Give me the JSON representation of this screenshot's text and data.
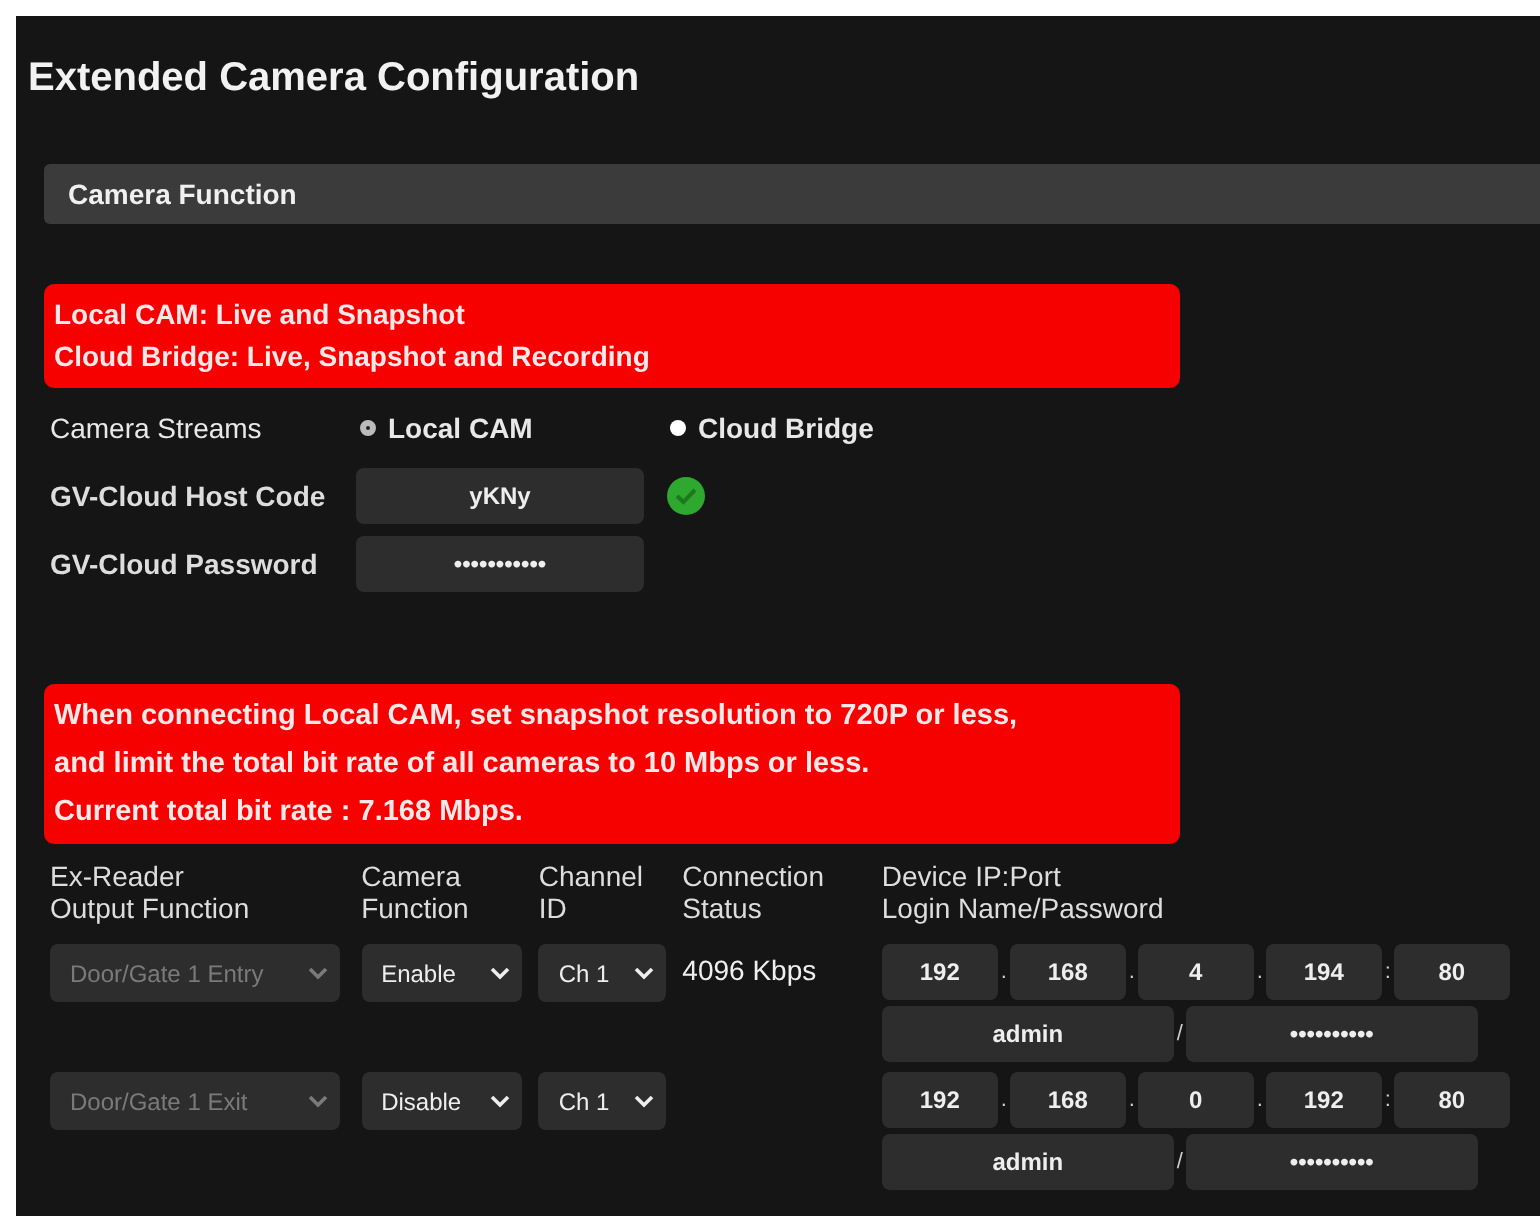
{
  "page_title": "Extended Camera Configuration",
  "section": {
    "title": "Camera Function"
  },
  "notice": [
    "Local CAM: Live and Snapshot",
    "Cloud Bridge: Live, Snapshot and Recording"
  ],
  "camera_streams": {
    "label": "Camera Streams",
    "options": [
      {
        "label": "Local CAM",
        "selected": true
      },
      {
        "label": "Cloud Bridge",
        "selected": false
      }
    ]
  },
  "fields": [
    {
      "label": "GV-Cloud Host Code",
      "value": "yKNy",
      "indicator": true
    },
    {
      "label": "GV-Cloud Password",
      "value": "•••••••••••",
      "indicator": false
    }
  ],
  "bitrate_notice": [
    "When connecting Local CAM, set snapshot resolution to 720P or less,",
    "and limit the total bit rate of all cameras to 10 Mbps or less.",
    "Current total bit rate : 7.168 Mbps."
  ],
  "table": {
    "columns": [
      "Ex-Reader\nOutput Function",
      "Camera\nFunction",
      "Channel\nID",
      "Connection\nStatus",
      "Device IP:Port\nLogin Name/Password"
    ],
    "rows": [
      {
        "output_function": {
          "value": "Door/Gate 1 Entry",
          "disabled": true
        },
        "camera_function": "Enable",
        "channel": "Ch 1",
        "connection_status": "4096 Kbps",
        "address": [
          {
            "kind": "octet",
            "text": "192"
          },
          {
            "kind": "sep",
            "text": "."
          },
          {
            "kind": "octet",
            "text": "168"
          },
          {
            "kind": "sep",
            "text": "."
          },
          {
            "kind": "octet",
            "text": "4"
          },
          {
            "kind": "sep",
            "text": "."
          },
          {
            "kind": "octet",
            "text": "194"
          },
          {
            "kind": "sep",
            "text": ":"
          },
          {
            "kind": "octet",
            "text": "80"
          }
        ],
        "login": [
          {
            "kind": "field",
            "text": "admin"
          },
          {
            "kind": "sep",
            "text": "/"
          },
          {
            "kind": "field",
            "text": "••••••••••"
          }
        ]
      },
      {
        "output_function": {
          "value": "Door/Gate 1 Exit",
          "disabled": true
        },
        "camera_function": "Disable",
        "channel": "Ch 1",
        "address": [
          {
            "kind": "octet",
            "text": "192"
          },
          {
            "kind": "sep",
            "text": "."
          },
          {
            "kind": "octet",
            "text": "168"
          },
          {
            "kind": "sep",
            "text": "."
          },
          {
            "kind": "octet",
            "text": "0"
          },
          {
            "kind": "sep",
            "text": "."
          },
          {
            "kind": "octet",
            "text": "192"
          },
          {
            "kind": "sep",
            "text": ":"
          },
          {
            "kind": "octet",
            "text": "80"
          }
        ],
        "login": [
          {
            "kind": "field",
            "text": "admin"
          },
          {
            "kind": "sep",
            "text": "/"
          },
          {
            "kind": "field",
            "text": "••••••••••"
          }
        ]
      }
    ]
  }
}
